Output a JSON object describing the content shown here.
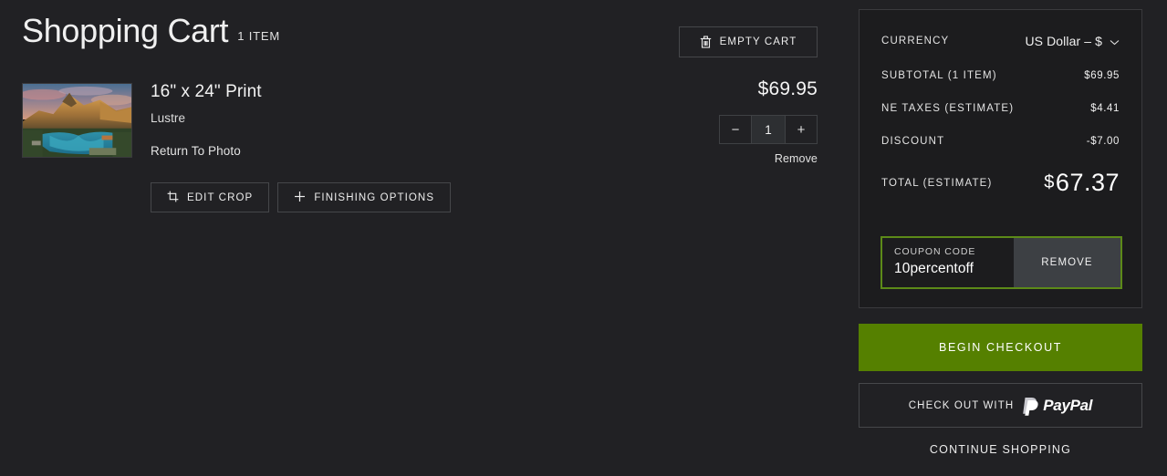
{
  "header": {
    "title": "Shopping Cart",
    "item_count_label": "1 ITEM",
    "empty_cart_label": "EMPTY CART",
    "trash_icon": "trash-icon"
  },
  "item": {
    "thumbnail_alt": "mountain-lake-landscape-photo",
    "title": "16\" x 24\" Print",
    "finish": "Lustre",
    "return_link": "Return To Photo",
    "edit_crop_label": "EDIT CROP",
    "crop_icon": "crop-icon",
    "finishing_options_label": "FINISHING OPTIONS",
    "plus_icon": "plus-icon",
    "price": "$69.95",
    "quantity": "1",
    "decrease_label": "−",
    "increase_label": "+",
    "remove_label": "Remove"
  },
  "summary": {
    "currency_label": "CURRENCY",
    "currency_value": "US Dollar – $",
    "currency_chevron": "chevron-down-icon",
    "subtotal_label": "SUBTOTAL (1 ITEM)",
    "subtotal_value": "$69.95",
    "taxes_label": "NE TAXES (ESTIMATE)",
    "taxes_value": "$4.41",
    "discount_label": "DISCOUNT",
    "discount_value": "-$7.00",
    "total_label": "TOTAL (ESTIMATE)",
    "total_currency_symbol": "$",
    "total_value": "67.37",
    "coupon_label": "COUPON CODE",
    "coupon_value": "10percentoff",
    "coupon_remove_label": "REMOVE"
  },
  "actions": {
    "begin_checkout_label": "BEGIN CHECKOUT",
    "paypal_prefix": "CHECK OUT WITH",
    "paypal_wordmark": "PayPal",
    "continue_shopping_label": "CONTINUE SHOPPING"
  },
  "colors": {
    "page_background": "#212124",
    "panel_background": "#1c1c1e",
    "border": "#46474a",
    "accent_green": "#558000",
    "coupon_border_green": "#5c8a18",
    "remove_button_gray": "#3d4044"
  }
}
